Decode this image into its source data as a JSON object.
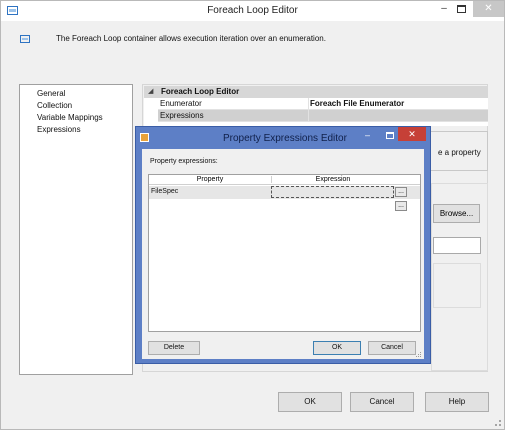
{
  "window": {
    "title": "Foreach Loop Editor",
    "minimize_glyph": "–",
    "close_glyph": "✕",
    "description": "The Foreach Loop container allows execution iteration over an enumeration."
  },
  "sidebar": {
    "items": [
      {
        "label": "General"
      },
      {
        "label": "Collection"
      },
      {
        "label": "Variable Mappings"
      },
      {
        "label": "Expressions"
      }
    ]
  },
  "property_grid": {
    "category": "Foreach Loop Editor",
    "rows": [
      {
        "name": "Enumerator",
        "value": "Foreach File Enumerator"
      },
      {
        "name": "Expressions",
        "value": ""
      }
    ]
  },
  "description_panel": {
    "text": "e a property"
  },
  "background": {
    "browse_label": "Browse..."
  },
  "footer": {
    "ok_label": "OK",
    "cancel_label": "Cancel",
    "help_label": "Help"
  },
  "dialog": {
    "title": "Property Expressions Editor",
    "minimize_glyph": "–",
    "close_glyph": "✕",
    "label": "Property expressions:",
    "columns": [
      "Property",
      "Expression"
    ],
    "rows": [
      {
        "property": "FileSpec",
        "expression": ""
      }
    ],
    "ellipsis_label": "...",
    "delete_label": "Delete",
    "ok_label": "OK",
    "cancel_label": "Cancel"
  },
  "colors": {
    "dialog_frame": "#5d7fc6",
    "close_button": "#c64037",
    "selected_row": "#d0d0d0"
  },
  "icons": [
    "app-icon",
    "dialog-app-icon",
    "collapse-arrow-icon",
    "resize-grip-icon"
  ]
}
